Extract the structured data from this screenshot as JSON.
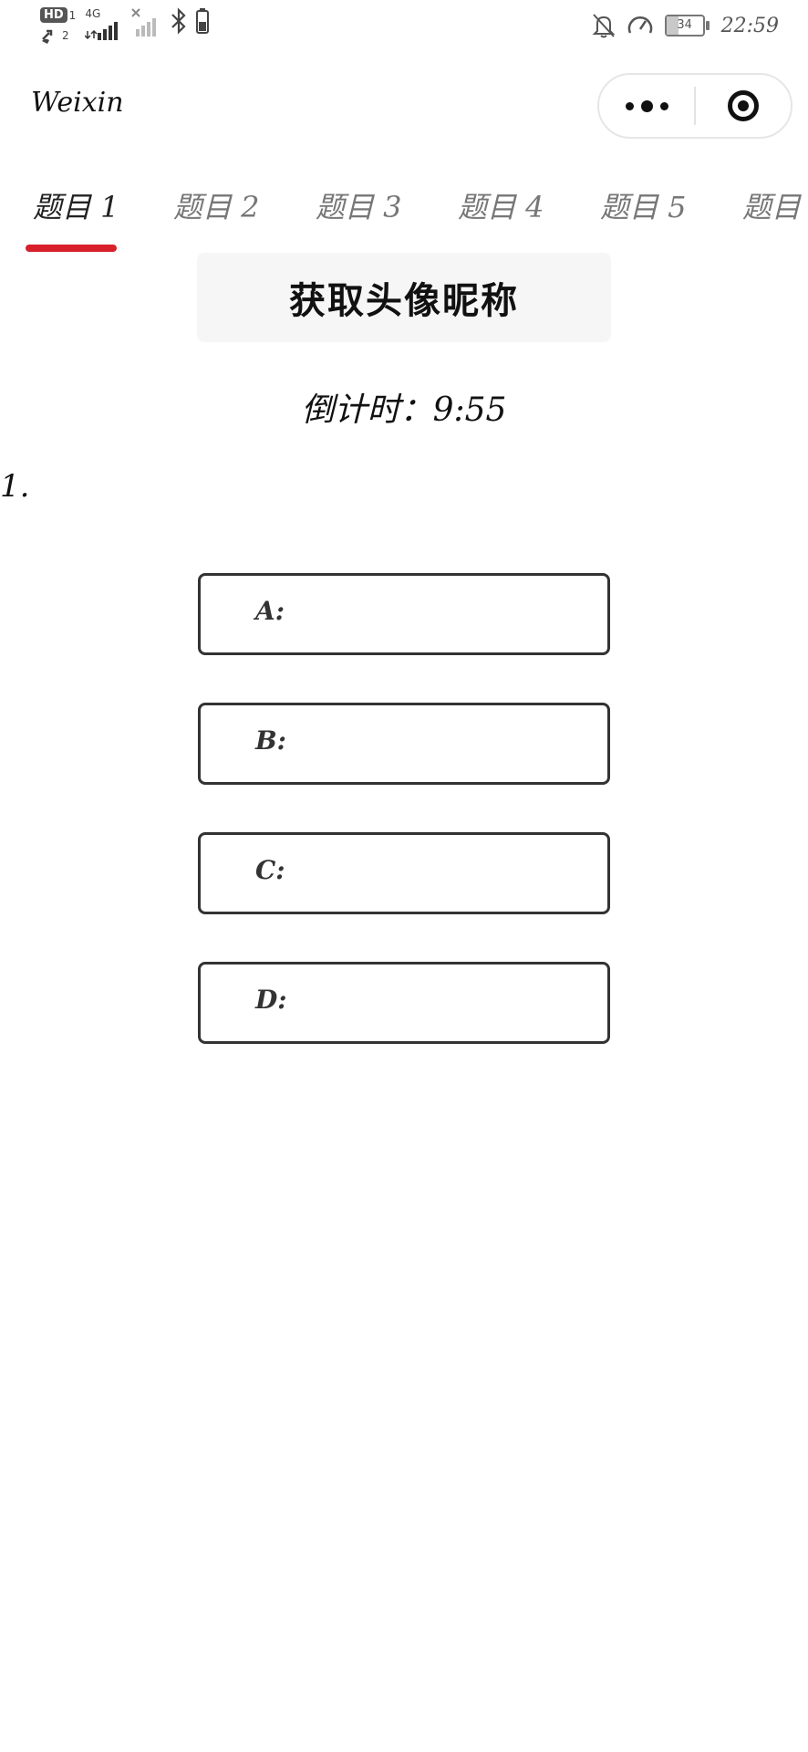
{
  "status_bar": {
    "hd_label": "HD",
    "sim1": "1",
    "sim2": "2",
    "network_label": "4G",
    "battery_level": "34",
    "battery_fraction": 0.34,
    "time": "22:59",
    "icons": [
      "missed-call-icon",
      "signal-icon",
      "no-signal-icon",
      "bluetooth-icon",
      "battery-small-icon",
      "mute-icon",
      "speedometer-icon",
      "battery-icon"
    ]
  },
  "header": {
    "title": "Weixin",
    "more_icon": "more-dots-icon",
    "close_icon": "target-circle-icon"
  },
  "tabs": {
    "items": [
      {
        "label": "题目 1"
      },
      {
        "label": "题目 2"
      },
      {
        "label": "题目 3"
      },
      {
        "label": "题目 4"
      },
      {
        "label": "题目 5"
      },
      {
        "label": "题目"
      }
    ],
    "active_index": 0,
    "indicator_color": "#d8202c"
  },
  "main": {
    "profile_button_label": "获取头像昵称",
    "countdown_text": "倒计时：9:55",
    "question_number": "1.",
    "options": [
      {
        "label": "A:"
      },
      {
        "label": "B:"
      },
      {
        "label": "C:"
      },
      {
        "label": "D:"
      }
    ]
  }
}
